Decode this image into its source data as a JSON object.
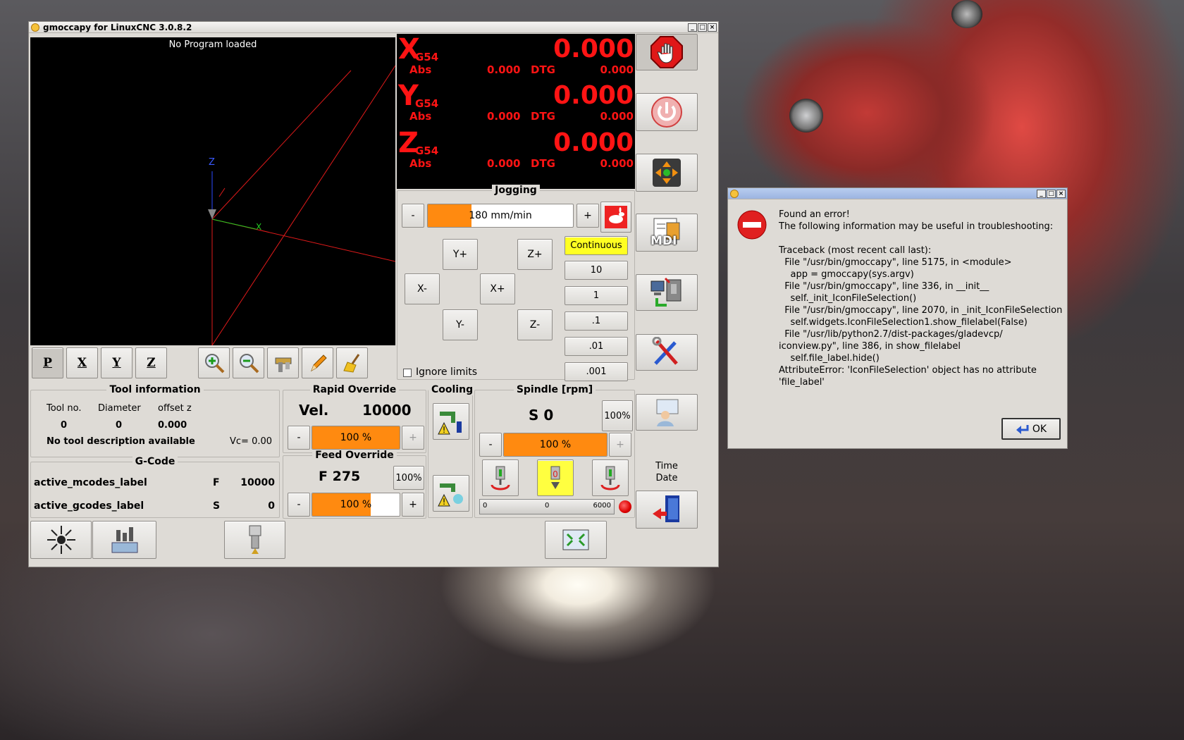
{
  "main_window": {
    "title": "gmoccapy for LinuxCNC  3.0.8.2",
    "win_buttons": [
      "_",
      "□",
      "×"
    ]
  },
  "preview": {
    "program_label": "No Program loaded",
    "axis_z": "Z",
    "axis_x": "X",
    "view_buttons": [
      "P",
      "X",
      "Y",
      "Z"
    ]
  },
  "dro": {
    "rows": [
      {
        "axis": "X",
        "offset": "G54",
        "value": "0.000",
        "abs_label": "Abs",
        "abs": "0.000",
        "dtg_label": "DTG",
        "dtg": "0.000"
      },
      {
        "axis": "Y",
        "offset": "G54",
        "value": "0.000",
        "abs_label": "Abs",
        "abs": "0.000",
        "dtg_label": "DTG",
        "dtg": "0.000"
      },
      {
        "axis": "Z",
        "offset": "G54",
        "value": "0.000",
        "abs_label": "Abs",
        "abs": "0.000",
        "dtg_label": "DTG",
        "dtg": "0.000"
      }
    ]
  },
  "jogging": {
    "title": "Jogging",
    "minus": "-",
    "plus": "+",
    "speed_text": "180 mm/min",
    "speed_fraction": 0.3,
    "yplus": "Y+",
    "zplus": "Z+",
    "xminus": "X-",
    "xplus": "X+",
    "yminus": "Y-",
    "zminus": "Z-",
    "increments": [
      "Continuous",
      "10",
      "1",
      ".1",
      ".01",
      ".001"
    ],
    "ignore_limits": "Ignore limits",
    "active_color": "#ffff22"
  },
  "tool_info": {
    "title": "Tool information",
    "headers": [
      "Tool no.",
      "Diameter",
      "offset z"
    ],
    "values": [
      "0",
      "0",
      "0.000"
    ],
    "description": "No tool description available",
    "vc": "Vc= 0.00"
  },
  "gcode": {
    "title": "G-Code",
    "mcodes": "active_mcodes_label",
    "gcodes": "active_gcodes_label",
    "f_label": "F",
    "f_value": "10000",
    "s_label": "S",
    "s_value": "0"
  },
  "rapid_override": {
    "title": "Rapid Override",
    "vel_label": "Vel.",
    "vel_value": "10000",
    "minus": "-",
    "plus": "+",
    "bar_text": "100 %",
    "fraction": 1.0
  },
  "feed_override": {
    "title": "Feed Override",
    "f_text": "F 275",
    "percent_btn": "100%",
    "minus": "-",
    "plus": "+",
    "bar_text": "100 %",
    "fraction": 0.67
  },
  "cooling": {
    "title": "Cooling"
  },
  "spindle": {
    "title": "Spindle [rpm]",
    "s_text": "S 0",
    "percent_btn": "100%",
    "minus": "-",
    "plus": "+",
    "bar_text": "100 %",
    "fraction": 1.0,
    "gauge_min": "0",
    "gauge_val": "0",
    "gauge_max": "6000"
  },
  "side": {
    "mdi_label": "MDI",
    "time_label": "Time",
    "date_label": "Date"
  },
  "error_dialog": {
    "win_buttons": [
      "_",
      "□",
      "×"
    ],
    "lines": [
      "Found an error!",
      "The following information may be useful in troubleshooting:",
      "",
      "Traceback (most recent call last):",
      "  File \"/usr/bin/gmoccapy\", line 5175, in <module>",
      "    app = gmoccapy(sys.argv)",
      "  File \"/usr/bin/gmoccapy\", line 336, in __init__",
      "    self._init_IconFileSelection()",
      "  File \"/usr/bin/gmoccapy\", line 2070, in _init_IconFileSelection",
      "    self.widgets.IconFileSelection1.show_filelabel(False)",
      "  File \"/usr/lib/python2.7/dist-packages/gladevcp/",
      "iconview.py\", line 386, in show_filelabel",
      "    self.file_label.hide()",
      "AttributeError: 'IconFileSelection' object has no attribute",
      "'file_label'"
    ],
    "ok": "OK"
  }
}
